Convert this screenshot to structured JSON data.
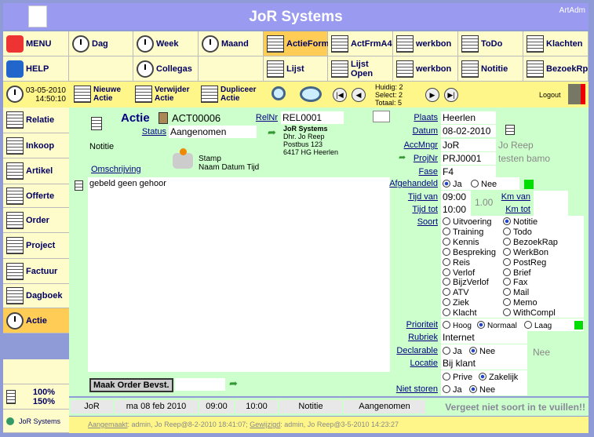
{
  "app": {
    "title": "JoR Systems",
    "user": "ArtAdm"
  },
  "toolbar": {
    "row1": [
      "MENU",
      "Dag",
      "Week",
      "Maand",
      "ActieForm",
      "ActFrmA4",
      "werkbon",
      "ToDo",
      "Klachten"
    ],
    "row2": [
      "HELP",
      "",
      "Collegas",
      "",
      "Lijst",
      "Lijst Open",
      "werkbon",
      "Notitie",
      "BezoekRp"
    ],
    "active": "ActieForm"
  },
  "actions": {
    "date": "03-05-2010",
    "time": "14:50:10",
    "new": [
      "Nieuwe",
      "Actie"
    ],
    "delete": [
      "Verwijder",
      "Actie"
    ],
    "duplicate": [
      "Dupliceer",
      "Actie"
    ],
    "huidig": "Huidig: 2",
    "select": "Select: 2",
    "totaal": "Totaal: 5",
    "logout": "Logout"
  },
  "sidebar": {
    "items": [
      "Relatie",
      "Inkoop",
      "Artikel",
      "Offerte",
      "Order",
      "Project",
      "Factuur",
      "Dagboek",
      "Actie"
    ],
    "active": "Actie",
    "zoom": [
      "100%",
      "150%"
    ],
    "company": "JoR Systems"
  },
  "form": {
    "heading": "Actie",
    "id": "ACT00006",
    "status_label": "Status",
    "status": "Aangenomen",
    "type_text": "Notitie",
    "relnr_label": "RelNr",
    "relnr": "REL0001",
    "rel_name": "JoR Systems",
    "rel_contact": "Dhr. Jo Reep",
    "rel_addr": "Postbus 123",
    "rel_city": "6417 HG Heerlen",
    "stamp": "Stamp",
    "stamp_sub": "Naam Datum Tijd",
    "omschrijving_label": "Omschrijving",
    "omschrijving": "gebeld geen gehoor",
    "plaats_label": "Plaats",
    "plaats": "Heerlen",
    "datum_label": "Datum",
    "datum": "08-02-2010",
    "accmngr_label": "AccMngr",
    "accmngr": "JoR",
    "accmngr_name": "Jo Reep",
    "projnr_label": "ProjNr",
    "projnr": "PRJ0001",
    "proj_name": "testen bamo",
    "fase_label": "Fase",
    "fase": "F4",
    "afgehandeld_label": "Afgehandeld",
    "ja": "Ja",
    "nee": "Nee",
    "tijdvan_label": "Tijd van",
    "tijdvan": "09:00",
    "tijdtot_label": "Tijd tot",
    "tijdtot": "10:00",
    "duur": "1.00",
    "kmvan_label": "Km van",
    "kmtot_label": "Km tot",
    "soort_label": "Soort",
    "soort_left": [
      "Uitvoering",
      "Training",
      "Kennis",
      "Bespreking",
      "Reis",
      "Verlof",
      "BijzVerlof",
      "ATV",
      "Ziek",
      "Klacht"
    ],
    "soort_right": [
      "Notitie",
      "Todo",
      "BezoekRap",
      "WerkBon",
      "PostReg",
      "Brief",
      "Fax",
      "Mail",
      "Memo",
      "WithCompl"
    ],
    "soort_selected": "Notitie",
    "prioriteit_label": "Prioriteit",
    "prioriteit": [
      "Hoog",
      "Normaal",
      "Laag"
    ],
    "prioriteit_selected": "Normaal",
    "rubriek_label": "Rubriek",
    "rubriek": "Internet",
    "declarable_label": "Declarable",
    "declarable_gray": "Nee",
    "locatie_label": "Locatie",
    "locatie": "Bij klant",
    "prive": "Prive",
    "zakelijk": "Zakelijk",
    "nietstoren_label": "Niet storen",
    "order_button": "Maak Order Bevst.",
    "status_green": "#00dd00"
  },
  "statusbar": {
    "cells": [
      "JoR",
      "ma 08 feb 2010",
      "09:00",
      "10:00",
      "Notitie",
      "Aangenomen"
    ],
    "warning": "Vergeet niet soort in te vuillen!!"
  },
  "footer": {
    "created_label": "Aangemaakt",
    "created": ": admin, Jo Reep@8-2-2010 18:41:07; ",
    "changed_label": "Gewijzigd",
    "changed": ": admin, Jo Reep@3-5-2010 14:23:27"
  }
}
